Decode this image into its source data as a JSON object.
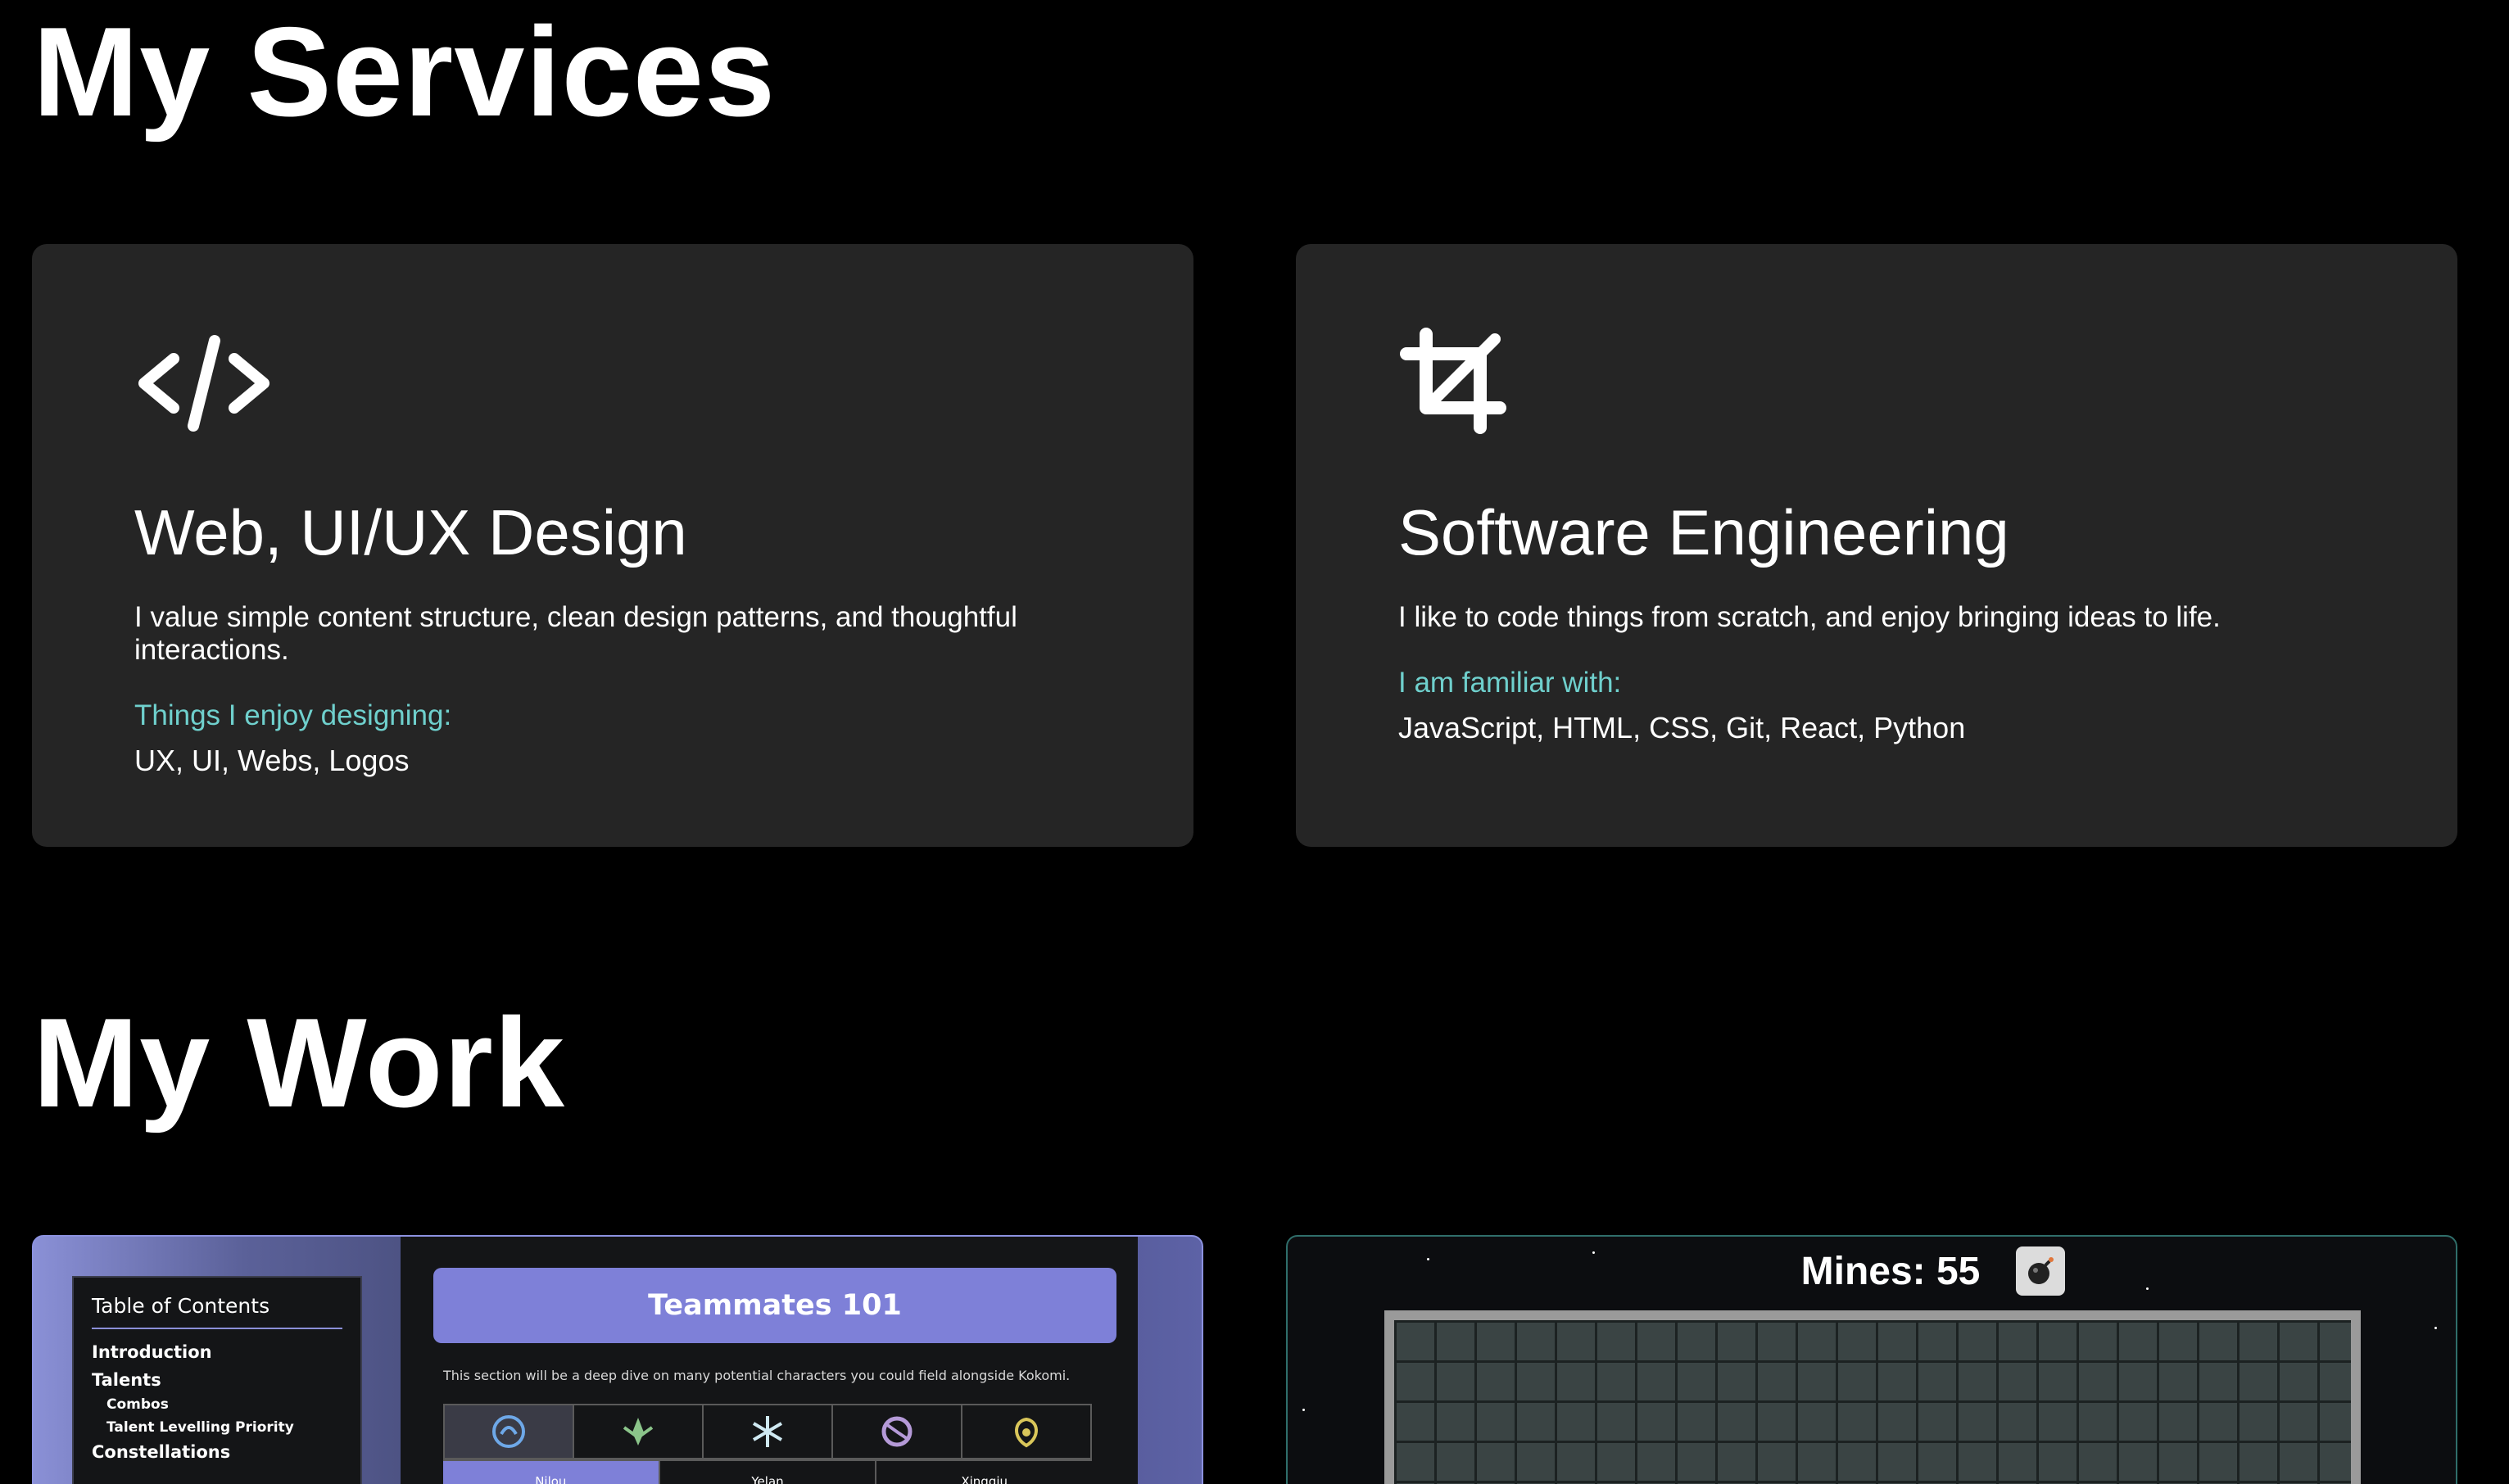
{
  "services": {
    "title": "My Services",
    "cards": [
      {
        "icon": "code-icon",
        "title": "Web, UI/UX Design",
        "description": "I value simple content structure, clean design patterns, and thoughtful interactions.",
        "subheading": "Things I enjoy designing:",
        "list": "UX, UI, Webs, Logos"
      },
      {
        "icon": "crop-icon",
        "title": "Software Engineering",
        "description": "I like to code things from scratch, and enjoy bringing ideas to life.",
        "subheading": "I am familiar with:",
        "list": "JavaScript, HTML, CSS, Git, React, Python"
      }
    ]
  },
  "work": {
    "title": "My Work",
    "genshin": {
      "toc_title": "Table of Contents",
      "toc_items": [
        "Introduction",
        "Talents",
        "Combos",
        "Talent Levelling Priority",
        "Constellations"
      ],
      "banner": "Teammates 101",
      "note": "This section will be a deep dive on many potential characters you could field alongside Kokomi.",
      "characters": [
        "Nilou",
        "Yelan",
        "Xingqiu"
      ]
    },
    "minesweeper": {
      "mines_label": "Mines: 55",
      "bomb_icon": "bomb-icon"
    }
  },
  "colors": {
    "background": "#000000",
    "card": "#252525",
    "accent": "#6fd0cd",
    "banner": "#7e80d8"
  }
}
